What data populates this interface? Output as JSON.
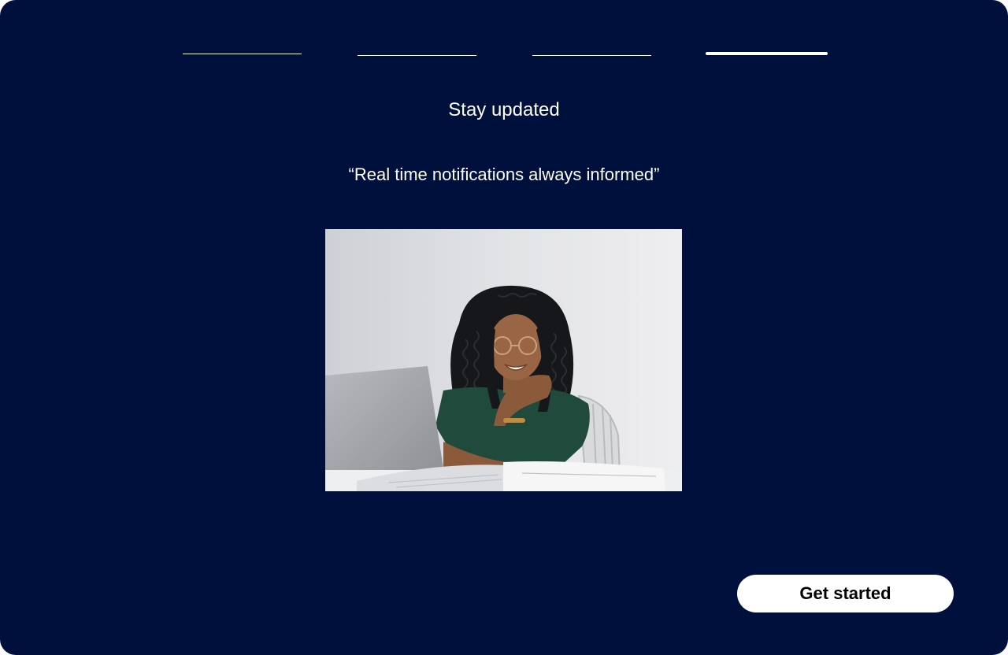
{
  "onboarding": {
    "steps": [
      {
        "index": 1,
        "active": false
      },
      {
        "index": 2,
        "active": false
      },
      {
        "index": 3,
        "active": false
      },
      {
        "index": 4,
        "active": true
      }
    ],
    "current_step": 4,
    "total_steps": 4,
    "title": "Stay updated",
    "quote": "“Real time notifications always informed”",
    "image": {
      "semantic": "woman-with-laptop-photo"
    },
    "cta_label": "Get started"
  },
  "colors": {
    "background": "#00103d",
    "text": "#ffffff",
    "button_bg": "#ffffff",
    "button_text": "#000000"
  }
}
